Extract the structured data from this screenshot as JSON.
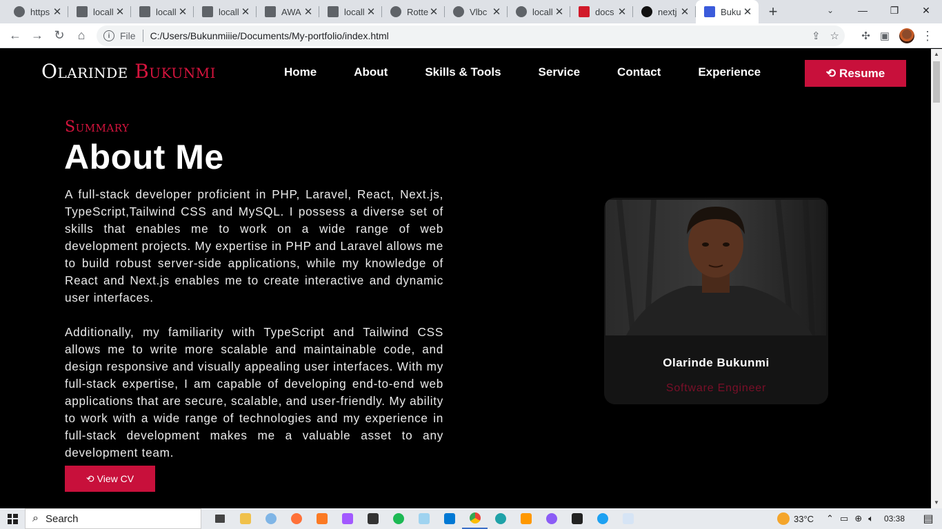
{
  "browser": {
    "tabs": [
      {
        "title": "https",
        "icon": "globe-icon",
        "color": "#5f6368"
      },
      {
        "title": "locall",
        "icon": "box-icon",
        "color": "#5f6368"
      },
      {
        "title": "locall",
        "icon": "chart-icon",
        "color": "#5f6368"
      },
      {
        "title": "locall",
        "icon": "box-icon",
        "color": "#5f6368"
      },
      {
        "title": "AWA",
        "icon": "grid-icon",
        "color": "#5f6368"
      },
      {
        "title": "locall",
        "icon": "doc-icon",
        "color": "#5f6368"
      },
      {
        "title": "Rotte",
        "icon": "globe-icon",
        "color": "#5f6368"
      },
      {
        "title": "Vlbc",
        "icon": "globe-icon",
        "color": "#5f6368"
      },
      {
        "title": "locall",
        "icon": "globe-icon",
        "color": "#5f6368"
      },
      {
        "title": "docs",
        "icon": "docs-icon",
        "color": "#d11a2a"
      },
      {
        "title": "nextj",
        "icon": "next-icon",
        "color": "#111111"
      },
      {
        "title": "Buku",
        "icon": "books-icon",
        "color": "#3b5bdb",
        "active": true
      }
    ],
    "new_tab": "+",
    "url": "C:/Users/Bukunmiiie/Documents/My-portfolio/index.html",
    "url_scheme_label": "File",
    "window_controls": {
      "minimize": "—",
      "maximize": "❐",
      "close": "✕"
    }
  },
  "site": {
    "brand_first": "Olarinde",
    "brand_last": "Bukunmi",
    "nav": [
      "Home",
      "About",
      "Skills & Tools",
      "Service",
      "Contact",
      "Experience"
    ],
    "resume_label": "Resume",
    "accent_color": "#c8103b"
  },
  "about": {
    "kicker": "Summary",
    "title": "About Me",
    "paragraphs": [
      "A full-stack developer proficient in PHP, Laravel, React, Next.js, TypeScript,Tailwind CSS and MySQL. I possess a diverse set of skills that enables me to work on a wide range of web development projects. My expertise in PHP and Laravel allows me to build robust server-side applications, while my knowledge of React and Next.js enables me to create interactive and dynamic user interfaces.",
      "Additionally, my familiarity with TypeScript and Tailwind CSS allows me to write more scalable and maintainable code, and design responsive and visually appealing user interfaces. With my full-stack expertise, I am capable of developing end-to-end web applications that are secure, scalable, and user-friendly. My ability to work with a wide range of technologies and my experience in full-stack development makes me a valuable asset to any development team."
    ],
    "cv_label": "View CV"
  },
  "profile": {
    "name": "Olarinde Bukunmi",
    "role": "Software Engineer"
  },
  "taskbar": {
    "search_label": "Search",
    "weather": "33°C",
    "time": "03:38"
  }
}
